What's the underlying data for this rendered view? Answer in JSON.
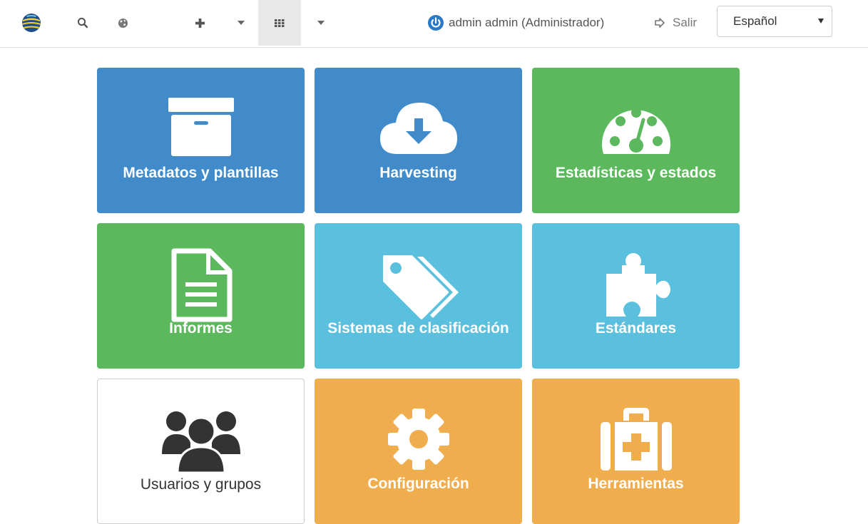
{
  "navbar": {
    "logo_icon": "geonetwork-globe-logo",
    "search_icon": "search-icon",
    "map_icon": "globe-icon",
    "add_icon": "plus-icon",
    "add_menu_icon": "caret-down-icon",
    "admin_icon": "grid-icon",
    "admin_menu_icon": "caret-down-icon",
    "user_label": "admin admin (Administrador)",
    "logout_label": "Salir",
    "language": {
      "selected": "Español"
    }
  },
  "tiles": [
    {
      "label": "Metadatos y plantillas",
      "icon": "archive-box-icon",
      "color": "#428bca"
    },
    {
      "label": "Harvesting",
      "icon": "cloud-download-icon",
      "color": "#428bca"
    },
    {
      "label": "Estadísticas y estados",
      "icon": "dashboard-gauge-icon",
      "color": "#5cb85c"
    },
    {
      "label": "Informes",
      "icon": "document-icon",
      "color": "#5cb85c"
    },
    {
      "label": "Sistemas de clasificación",
      "icon": "tags-icon",
      "color": "#5bc0de"
    },
    {
      "label": "Estándares",
      "icon": "puzzle-piece-icon",
      "color": "#5bc0de"
    },
    {
      "label": "Usuarios y grupos",
      "icon": "users-icon",
      "color": "#ffffff"
    },
    {
      "label": "Configuración",
      "icon": "gear-icon",
      "color": "#f0ad4e"
    },
    {
      "label": "Herramientas",
      "icon": "medkit-icon",
      "color": "#f0ad4e"
    }
  ]
}
